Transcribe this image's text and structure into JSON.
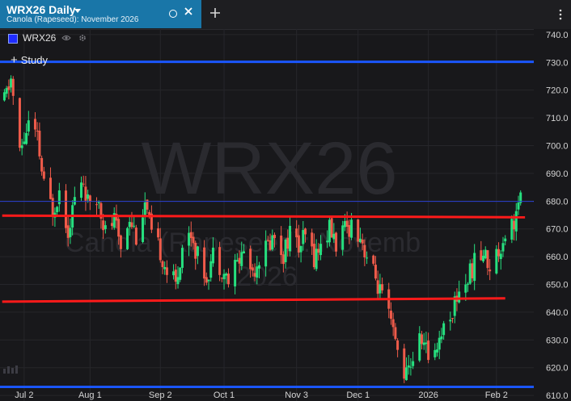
{
  "tab": {
    "title": "WRX26 Daily",
    "subtitle": "Canola (Rapeseed): November 2026"
  },
  "legend": {
    "symbol": "WRX26"
  },
  "study_button": {
    "label": "Study"
  },
  "watermark": {
    "symbol": "WRX26",
    "description_line1": "Canola (Rapeseed): Novemb",
    "description_line2": "2026"
  },
  "colors": {
    "up": "#26e07f",
    "down": "#ef5b4a",
    "support_resistance": "#ff1a1a",
    "horizontal_blue": "#1a56ff",
    "active_tab": "#1976a8",
    "background": "#18181b"
  },
  "chart_data": {
    "type": "candlestick",
    "y_axis": {
      "range": [
        608,
        742
      ],
      "ticks": [
        740,
        730,
        720,
        710,
        700,
        690,
        680,
        670,
        660,
        650,
        640,
        630,
        620,
        610
      ],
      "tick_labels": [
        "740.0",
        "730.0",
        "720.0",
        "710.0",
        "700.0",
        "690.0",
        "680.0",
        "670.0",
        "660.0",
        "650.0",
        "640.0",
        "630.0",
        "620.0",
        "610.0"
      ]
    },
    "x_axis": {
      "range": [
        "2025-06-21",
        "2026-02-19"
      ],
      "ticks": [
        "2025-07-02",
        "2025-08-01",
        "2025-09-02",
        "2025-10-01",
        "2025-11-03",
        "2025-12-01",
        "2026-01-02",
        "2026-02-02"
      ],
      "tick_labels": [
        "Jul 2",
        "Aug 1",
        "Sep 2",
        "Oct 1",
        "Nov 3",
        "Dec 1",
        "2026",
        "Feb 2"
      ]
    },
    "horizontal_lines": [
      {
        "value": 730.2,
        "label": "730.2",
        "color": "#1a56ff"
      },
      {
        "value": 613.1,
        "label": "613.1",
        "color": "#1a56ff"
      }
    ],
    "last_price": {
      "value": 679.9,
      "label": "679.9"
    },
    "trend_lines": [
      {
        "start": [
          "2025-06-22",
          674.8
        ],
        "end": [
          "2026-02-15",
          674.2
        ],
        "color": "#ff1a1a"
      },
      {
        "start": [
          "2025-06-22",
          643.8
        ],
        "end": [
          "2026-02-06",
          645.0
        ],
        "color": "#ff1a1a"
      }
    ],
    "keypoints": [
      [
        "2025-06-23",
        716
      ],
      [
        "2025-06-26",
        724
      ],
      [
        "2025-06-30",
        697
      ],
      [
        "2025-07-04",
        708
      ],
      [
        "2025-07-08",
        702
      ],
      [
        "2025-07-11",
        685
      ],
      [
        "2025-07-15",
        677
      ],
      [
        "2025-07-18",
        684
      ],
      [
        "2025-07-22",
        670
      ],
      [
        "2025-07-25",
        681
      ],
      [
        "2025-07-29",
        687
      ],
      [
        "2025-08-01",
        676
      ],
      [
        "2025-08-05",
        681
      ],
      [
        "2025-08-08",
        669
      ],
      [
        "2025-08-12",
        673
      ],
      [
        "2025-08-15",
        664
      ],
      [
        "2025-08-19",
        675
      ],
      [
        "2025-08-22",
        668
      ],
      [
        "2025-08-26",
        679
      ],
      [
        "2025-08-29",
        667
      ],
      [
        "2025-09-02",
        662
      ],
      [
        "2025-09-05",
        655
      ],
      [
        "2025-09-09",
        650
      ],
      [
        "2025-09-12",
        664
      ],
      [
        "2025-09-16",
        669
      ],
      [
        "2025-09-19",
        660
      ],
      [
        "2025-09-23",
        653
      ],
      [
        "2025-09-26",
        661
      ],
      [
        "2025-09-30",
        656
      ],
      [
        "2025-10-03",
        651
      ],
      [
        "2025-10-07",
        658
      ],
      [
        "2025-10-10",
        662
      ],
      [
        "2025-10-14",
        655
      ],
      [
        "2025-10-17",
        660
      ],
      [
        "2025-10-21",
        664
      ],
      [
        "2025-10-24",
        668
      ],
      [
        "2025-10-28",
        661
      ],
      [
        "2025-10-31",
        669
      ],
      [
        "2025-11-04",
        663
      ],
      [
        "2025-11-07",
        667
      ],
      [
        "2025-11-11",
        660
      ],
      [
        "2025-11-14",
        664
      ],
      [
        "2025-11-18",
        670
      ],
      [
        "2025-11-21",
        665
      ],
      [
        "2025-11-25",
        669
      ],
      [
        "2025-11-28",
        672
      ],
      [
        "2025-12-02",
        668
      ],
      [
        "2025-12-05",
        660
      ],
      [
        "2025-12-09",
        652
      ],
      [
        "2025-12-12",
        645
      ],
      [
        "2025-12-16",
        635
      ],
      [
        "2025-12-19",
        626
      ],
      [
        "2025-12-23",
        617
      ],
      [
        "2025-12-26",
        624
      ],
      [
        "2025-12-30",
        631
      ],
      [
        "2026-01-02",
        624
      ],
      [
        "2026-01-06",
        629
      ],
      [
        "2026-01-09",
        635
      ],
      [
        "2026-01-13",
        641
      ],
      [
        "2026-01-16",
        648
      ],
      [
        "2026-01-20",
        652
      ],
      [
        "2026-01-23",
        658
      ],
      [
        "2026-01-27",
        661
      ],
      [
        "2026-01-30",
        657
      ],
      [
        "2026-02-03",
        662
      ],
      [
        "2026-02-06",
        669
      ],
      [
        "2026-02-10",
        673
      ],
      [
        "2026-02-13",
        680
      ]
    ]
  }
}
